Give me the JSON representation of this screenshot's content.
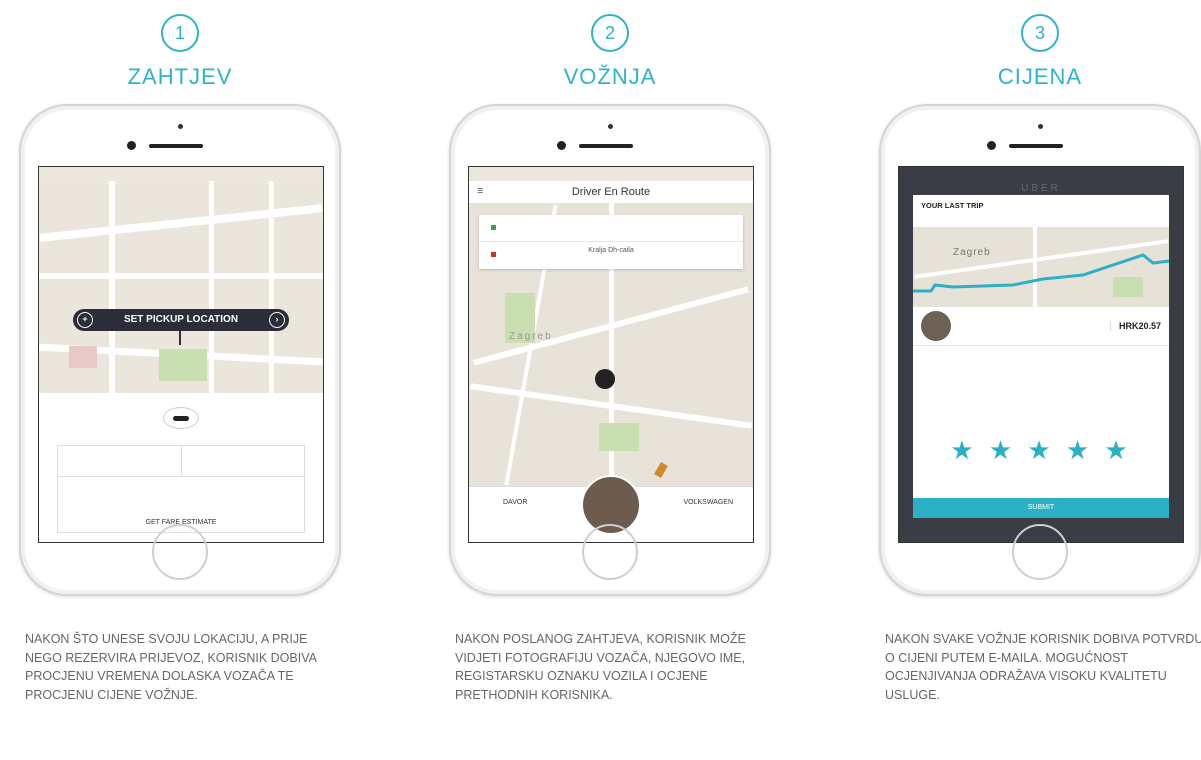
{
  "steps": [
    {
      "number": "1",
      "title": "ZAHTJEV",
      "caption": "NAKON ŠTO UNESE SVOJU LOKACIJU, A PRIJE NEGO REZERVIRA PRIJEVOZ, KORISNIK DOBIVA PROCJENU VREMENA DOLASKA VOZAČA TE PROCJENU CIJENE VOŽNJE.",
      "screen": {
        "pickup_label": "SET PICKUP LOCATION",
        "fare_button": "GET FARE ESTIMATE"
      }
    },
    {
      "number": "2",
      "title": "VOŽNJA",
      "caption": "NAKON POSLANOG ZAHTJEVA, KORISNIK MOŽE VIDJETI FOTOGRAFIJU VOZAČA, NJEGOVO IME, REGISTARSKU OZNAKU VOZILA I OCJENE PRETHODNIH KORISNIKA.",
      "screen": {
        "header": "Driver En Route",
        "destination": "Kralja Dh-caila",
        "map_label": "Zagreb",
        "driver_name": "DAVOR",
        "vehicle": "VOLKSWAGEN"
      }
    },
    {
      "number": "3",
      "title": "CIJENA",
      "caption": "NAKON SVAKE VOŽNJE KORISNIK DOBIVA POTVRDU O CIJENI PUTEM E-MAILA. MOGUĆNOST OCJENJIVANJA ODRAŽAVA VISOKU KVALITETU USLUGE.",
      "screen": {
        "brand": "UBER",
        "trip_title": "YOUR LAST TRIP",
        "map_label": "Zagreb",
        "price": "HRK20.57",
        "stars": "★ ★ ★ ★ ★",
        "submit": "SUBMIT"
      }
    }
  ],
  "colors": {
    "accent": "#2fb3c8",
    "route": "#2bb0c6",
    "pickup_bar": "#2d2d3a"
  }
}
